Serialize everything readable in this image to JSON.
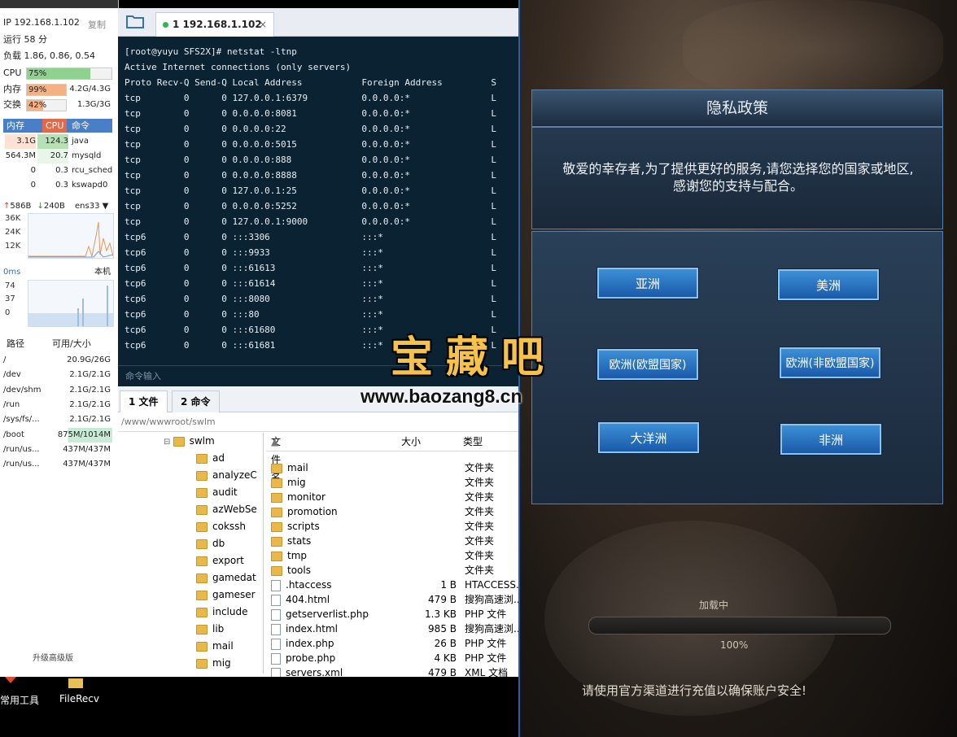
{
  "sidepanel": {
    "ip": "IP 192.168.1.102",
    "copy_label": "复制",
    "uptime": "运行 58 分",
    "load": "负载 1.86, 0.86, 0.54",
    "cpu": {
      "label": "CPU",
      "percent": 75,
      "text": "75%",
      "color": "#8fd18f"
    },
    "mem": {
      "label": "内存",
      "percent": 99,
      "text": "99%",
      "value": "4.2G/4.3G",
      "color": "#f4b183"
    },
    "swap": {
      "label": "交换",
      "percent": 42,
      "text": "42%",
      "value": "1.3G/3G",
      "color": "#f4b183"
    },
    "proc_headers": [
      "内存",
      "CPU",
      "命令"
    ],
    "processes": [
      {
        "mem": "3.1G",
        "cpu": "124.3",
        "cmd": "java"
      },
      {
        "mem": "564.3M",
        "cpu": "20.7",
        "cmd": "mysqld"
      },
      {
        "mem": "0",
        "cpu": "0.3",
        "cmd": "rcu_sched"
      },
      {
        "mem": "0",
        "cpu": "0.3",
        "cmd": "kswapd0"
      }
    ],
    "net": {
      "up": "586B",
      "down": "240B",
      "iface": "ens33",
      "ticks": [
        "36K",
        "24K",
        "12K"
      ]
    },
    "ping": {
      "label": "0ms",
      "host": "本机",
      "ticks": [
        "74",
        "37",
        "0"
      ]
    },
    "disk_headers": [
      "路径",
      "可用/大小"
    ],
    "disks": [
      {
        "path": "/",
        "size": "20.9G/26G"
      },
      {
        "path": "/dev",
        "size": "2.1G/2.1G"
      },
      {
        "path": "/dev/shm",
        "size": "2.1G/2.1G"
      },
      {
        "path": "/run",
        "size": "2.1G/2.1G"
      },
      {
        "path": "/sys/fs/...",
        "size": "2.1G/2.1G"
      },
      {
        "path": "/boot",
        "size": "875M/1014M"
      },
      {
        "path": "/run/us...",
        "size": "437M/437M"
      },
      {
        "path": "/run/us...",
        "size": "437M/437M"
      }
    ],
    "upgrade_label": "升级高级版"
  },
  "session_tab": {
    "label": "1 192.168.1.102",
    "close": "×"
  },
  "terminal": {
    "lines": [
      "[root@yuyu SFS2X]# netstat -ltnp",
      "Active Internet connections (only servers)",
      "Proto Recv-Q Send-Q Local Address           Foreign Address         S",
      "tcp        0      0 127.0.0.1:6379          0.0.0.0:*               L",
      "tcp        0      0 0.0.0.0:8081            0.0.0.0:*               L",
      "tcp        0      0 0.0.0.0:22              0.0.0.0:*               L",
      "tcp        0      0 0.0.0.0:5015            0.0.0.0:*               L",
      "tcp        0      0 0.0.0.0:888             0.0.0.0:*               L",
      "tcp        0      0 0.0.0.0:8888            0.0.0.0:*               L",
      "tcp        0      0 127.0.0.1:25            0.0.0.0:*               L",
      "tcp        0      0 0.0.0.0:5252            0.0.0.0:*               L",
      "tcp        0      0 127.0.0.1:9000          0.0.0.0:*               L",
      "tcp6       0      0 :::3306                 :::*                    L",
      "tcp6       0      0 :::9933                 :::*                    L",
      "tcp6       0      0 :::61613                :::*                    L",
      "tcp6       0      0 :::61614                :::*                    L",
      "tcp6       0      0 :::8080                 :::*                    L",
      "tcp6       0      0 :::80                   :::*                    L",
      "tcp6       0      0 :::61680                :::*                    L",
      "tcp6       0      0 :::61681                :::*                    L"
    ],
    "input_placeholder": "命令输入"
  },
  "bottom_tabs": [
    "1 文件",
    "2 命令"
  ],
  "path": "/www/wwwroot/swlm",
  "tree": {
    "root": "swlm",
    "items": [
      "ad",
      "analyzeC",
      "audit",
      "azWebSe",
      "cokssh",
      "db",
      "export",
      "gamedat",
      "gameser",
      "include",
      "lib",
      "mail",
      "mig"
    ]
  },
  "filelist": {
    "headers": [
      "文件名",
      "大小",
      "类型"
    ],
    "rows": [
      {
        "name": "mail",
        "size": "",
        "type": "文件夹",
        "kind": "folder"
      },
      {
        "name": "mig",
        "size": "",
        "type": "文件夹",
        "kind": "folder"
      },
      {
        "name": "monitor",
        "size": "",
        "type": "文件夹",
        "kind": "folder"
      },
      {
        "name": "promotion",
        "size": "",
        "type": "文件夹",
        "kind": "folder"
      },
      {
        "name": "scripts",
        "size": "",
        "type": "文件夹",
        "kind": "folder"
      },
      {
        "name": "stats",
        "size": "",
        "type": "文件夹",
        "kind": "folder"
      },
      {
        "name": "tmp",
        "size": "",
        "type": "文件夹",
        "kind": "folder"
      },
      {
        "name": "tools",
        "size": "",
        "type": "文件夹",
        "kind": "folder"
      },
      {
        "name": ".htaccess",
        "size": "1 B",
        "type": "HTACCESS...",
        "kind": "file"
      },
      {
        "name": "404.html",
        "size": "479 B",
        "type": "搜狗高速浏...",
        "kind": "file"
      },
      {
        "name": "getserverlist.php",
        "size": "1.3 KB",
        "type": "PHP 文件",
        "kind": "file"
      },
      {
        "name": "index.html",
        "size": "985 B",
        "type": "搜狗高速浏...",
        "kind": "file"
      },
      {
        "name": "index.php",
        "size": "26 B",
        "type": "PHP 文件",
        "kind": "file"
      },
      {
        "name": "probe.php",
        "size": "4 KB",
        "type": "PHP 文件",
        "kind": "file"
      },
      {
        "name": "servers.xml",
        "size": "479 B",
        "type": "XML 文档",
        "kind": "file"
      }
    ]
  },
  "taskbar": {
    "items": [
      "常用工具",
      "FileRecv"
    ]
  },
  "game": {
    "dialog_title": "隐私政策",
    "message_line1": "敬爱的幸存者,为了提供更好的服务,请您选择您的国家或地区,",
    "message_line2": "感谢您的支持与配合。",
    "buttons": [
      "亚洲",
      "美洲",
      "欧洲(欧盟国家)",
      "欧洲(非欧盟国家)",
      "大洋洲",
      "非洲"
    ],
    "loading": "加载中",
    "percent": "100%",
    "tip": "请使用官方渠道进行充值以确保账户安全!"
  },
  "watermark": {
    "logo": "宝藏吧",
    "url": "www.baozang8.cn"
  }
}
